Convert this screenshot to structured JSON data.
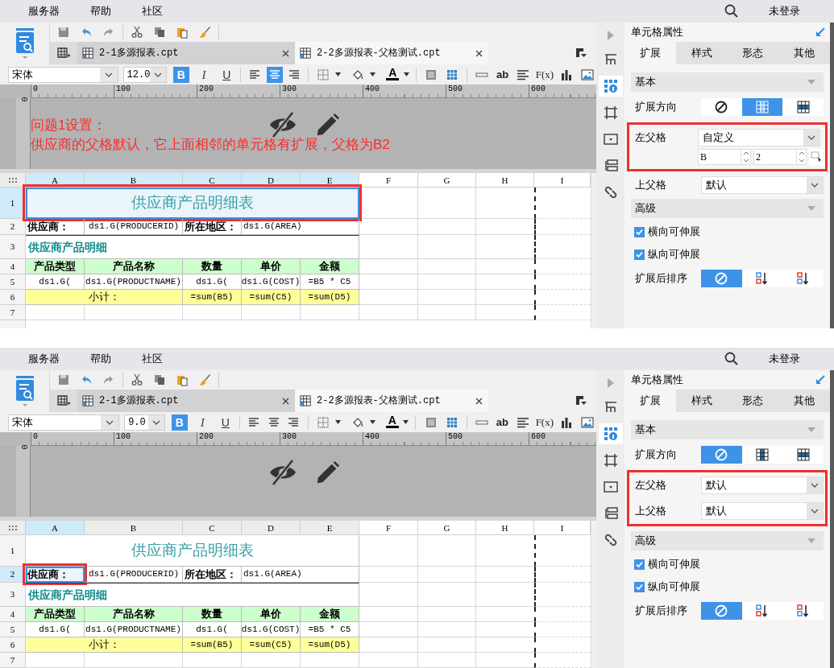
{
  "screens": [
    {
      "menu": [
        {
          "label": "服务器"
        },
        {
          "label": "帮助"
        },
        {
          "label": "社区"
        }
      ],
      "login": "未登录",
      "file_tabs": [
        {
          "label": "2-1多源报表.cpt",
          "selected": false
        },
        {
          "label": "2-2多源报表-父格测试.cpt",
          "selected": true
        }
      ],
      "format_bar": {
        "font": "宋体",
        "size": "12.0",
        "styles": [
          {
            "label": "B",
            "selected": true
          },
          {
            "label": "I",
            "selected": false
          },
          {
            "label": "U",
            "selected": false
          }
        ],
        "align": [
          {
            "selected": false
          },
          {
            "selected": true
          },
          {
            "selected": false
          }
        ],
        "font_color": "A",
        "text_tool": "ab",
        "formula_tool": "F(x)"
      },
      "ruler": [
        "0",
        "100",
        "200",
        "300",
        "400",
        "500",
        "600"
      ],
      "ruler_vertical": "0",
      "note": [
        "问题1设置：",
        "供应商的父格默认，它上面相邻的单元格有扩展，父格为B2"
      ],
      "sheet": {
        "callout": true,
        "columns": [
          {
            "label": "A",
            "selected": true
          },
          {
            "label": "B",
            "selected": true
          },
          {
            "label": "C",
            "selected": true
          },
          {
            "label": "D",
            "selected": true
          },
          {
            "label": "E",
            "selected": true
          },
          {
            "label": "F",
            "selected": false
          },
          {
            "label": "G",
            "selected": false
          },
          {
            "label": "H",
            "selected": false
          },
          {
            "label": "I",
            "selected": false
          }
        ],
        "rows": [
          {
            "number": "1",
            "selected": true,
            "kind": "title",
            "cells": [
              {
                "text": "供应商产品明细表",
                "selected": true
              }
            ]
          },
          {
            "number": "2",
            "selected": false,
            "kind": "info",
            "cells": [
              {
                "text": "供应商：",
                "selected": false
              },
              {
                "text": "ds1.G(PRODUCERID)",
                "selected": false
              },
              {
                "text": "所在地区：",
                "selected": false
              },
              {
                "text": "ds1.G(AREA)",
                "selected": false
              }
            ]
          },
          {
            "number": "3",
            "selected": false,
            "kind": "section",
            "cells": [
              {
                "text": "供应商产品明细",
                "selected": false
              }
            ]
          },
          {
            "number": "4",
            "selected": false,
            "kind": "header",
            "cells": [
              {
                "text": "产品类型",
                "selected": false
              },
              {
                "text": "产品名称",
                "selected": false
              },
              {
                "text": "数量",
                "selected": false
              },
              {
                "text": "单价",
                "selected": false
              },
              {
                "text": "金额",
                "selected": false
              }
            ]
          },
          {
            "number": "5",
            "selected": false,
            "kind": "data",
            "cells": [
              {
                "text": "ds1.G(",
                "selected": false
              },
              {
                "text": "ds1.G(PRODUCTNAME)",
                "selected": false
              },
              {
                "text": "ds1.G(",
                "selected": false
              },
              {
                "text": "ds1.G(COST)",
                "selected": false
              },
              {
                "text": "=B5 * C5",
                "selected": false
              }
            ]
          },
          {
            "number": "6",
            "selected": false,
            "kind": "subtotal",
            "cells": [
              {
                "text": "小计：",
                "selected": false
              },
              {
                "text": "=sum(B5)",
                "selected": false
              },
              {
                "text": "=sum(C5)",
                "selected": false
              },
              {
                "text": "=sum(D5)",
                "selected": false
              }
            ]
          },
          {
            "number": "7",
            "selected": false,
            "kind": "blank"
          }
        ]
      },
      "side_icons": [
        {
          "selected": false
        },
        {
          "selected": true
        },
        {
          "selected": false
        },
        {
          "selected": false
        },
        {
          "selected": false
        },
        {
          "selected": false
        }
      ],
      "panel": {
        "title": "单元格属性",
        "tabs": [
          {
            "label": "扩展",
            "selected": true
          },
          {
            "label": "样式",
            "selected": false
          },
          {
            "label": "形态",
            "selected": false
          },
          {
            "label": "其他",
            "selected": false
          }
        ],
        "basic_title": "基本",
        "direction_label": "扩展方向",
        "direction": [
          {
            "selected": false
          },
          {
            "selected": true
          },
          {
            "selected": false
          }
        ],
        "parents": [
          {
            "label": "左父格",
            "value": "自定义",
            "callout": true,
            "custom": {
              "column": "B",
              "row": "2"
            }
          },
          {
            "label": "上父格",
            "value": "默认",
            "callout": false
          }
        ],
        "advanced_title": "高级",
        "checks": [
          {
            "label": "横向可伸展",
            "checked": true
          },
          {
            "label": "纵向可伸展",
            "checked": true
          }
        ],
        "sort_label": "扩展后排序",
        "sort": [
          {
            "selected": true
          },
          {
            "selected": false
          },
          {
            "selected": false
          }
        ]
      }
    },
    {
      "menu": [
        {
          "label": "服务器"
        },
        {
          "label": "帮助"
        },
        {
          "label": "社区"
        }
      ],
      "login": "未登录",
      "file_tabs": [
        {
          "label": "2-1多源报表.cpt",
          "selected": false
        },
        {
          "label": "2-2多源报表-父格测试.cpt",
          "selected": true
        }
      ],
      "format_bar": {
        "font": "宋体",
        "size": "9.0",
        "styles": [
          {
            "label": "B",
            "selected": true
          },
          {
            "label": "I",
            "selected": false
          },
          {
            "label": "U",
            "selected": false
          }
        ],
        "align": [
          {
            "selected": false
          },
          {
            "selected": false
          },
          {
            "selected": false
          }
        ],
        "font_color": "A",
        "text_tool": "ab",
        "formula_tool": "F(x)"
      },
      "ruler": [
        "0",
        "100",
        "200",
        "300",
        "400",
        "500",
        "600"
      ],
      "ruler_vertical": "0",
      "sheet": {
        "callout": true,
        "columns": [
          {
            "label": "A",
            "selected": true
          },
          {
            "label": "B",
            "selected": false
          },
          {
            "label": "C",
            "selected": false
          },
          {
            "label": "D",
            "selected": false
          },
          {
            "label": "E",
            "selected": false
          },
          {
            "label": "F",
            "selected": false
          },
          {
            "label": "G",
            "selected": false
          },
          {
            "label": "H",
            "selected": false
          },
          {
            "label": "I",
            "selected": false
          }
        ],
        "rows": [
          {
            "number": "1",
            "selected": false,
            "kind": "title",
            "cells": [
              {
                "text": "供应商产品明细表",
                "selected": false
              }
            ]
          },
          {
            "number": "2",
            "selected": true,
            "kind": "info",
            "cells": [
              {
                "text": "供应商：",
                "selected": true
              },
              {
                "text": "ds1.G(PRODUCERID)",
                "selected": false
              },
              {
                "text": "所在地区：",
                "selected": false
              },
              {
                "text": "ds1.G(AREA)",
                "selected": false
              }
            ]
          },
          {
            "number": "3",
            "selected": false,
            "kind": "section",
            "cells": [
              {
                "text": "供应商产品明细",
                "selected": false
              }
            ]
          },
          {
            "number": "4",
            "selected": false,
            "kind": "header",
            "cells": [
              {
                "text": "产品类型",
                "selected": false
              },
              {
                "text": "产品名称",
                "selected": false
              },
              {
                "text": "数量",
                "selected": false
              },
              {
                "text": "单价",
                "selected": false
              },
              {
                "text": "金额",
                "selected": false
              }
            ]
          },
          {
            "number": "5",
            "selected": false,
            "kind": "data",
            "cells": [
              {
                "text": "ds1.G(",
                "selected": false
              },
              {
                "text": "ds1.G(PRODUCTNAME)",
                "selected": false
              },
              {
                "text": "ds1.G(",
                "selected": false
              },
              {
                "text": "ds1.G(COST)",
                "selected": false
              },
              {
                "text": "=B5 * C5",
                "selected": false
              }
            ]
          },
          {
            "number": "6",
            "selected": false,
            "kind": "subtotal",
            "cells": [
              {
                "text": "小计：",
                "selected": false
              },
              {
                "text": "=sum(B5)",
                "selected": false
              },
              {
                "text": "=sum(C5)",
                "selected": false
              },
              {
                "text": "=sum(D5)",
                "selected": false
              }
            ]
          },
          {
            "number": "7",
            "selected": false,
            "kind": "blank"
          }
        ]
      },
      "side_icons": [
        {
          "selected": false
        },
        {
          "selected": true
        },
        {
          "selected": false
        },
        {
          "selected": false
        },
        {
          "selected": false
        },
        {
          "selected": false
        }
      ],
      "panel": {
        "title": "单元格属性",
        "tabs": [
          {
            "label": "扩展",
            "selected": true
          },
          {
            "label": "样式",
            "selected": false
          },
          {
            "label": "形态",
            "selected": false
          },
          {
            "label": "其他",
            "selected": false
          }
        ],
        "basic_title": "基本",
        "direction_label": "扩展方向",
        "direction": [
          {
            "selected": true
          },
          {
            "selected": false
          },
          {
            "selected": false
          }
        ],
        "parents": [
          {
            "label": "左父格",
            "value": "默认",
            "callout": true
          },
          {
            "label": "上父格",
            "value": "默认",
            "callout": true
          }
        ],
        "advanced_title": "高级",
        "checks": [
          {
            "label": "横向可伸展",
            "checked": true
          },
          {
            "label": "纵向可伸展",
            "checked": true
          }
        ],
        "sort_label": "扩展后排序",
        "sort": [
          {
            "selected": true
          },
          {
            "selected": false
          },
          {
            "selected": false
          }
        ]
      }
    }
  ]
}
